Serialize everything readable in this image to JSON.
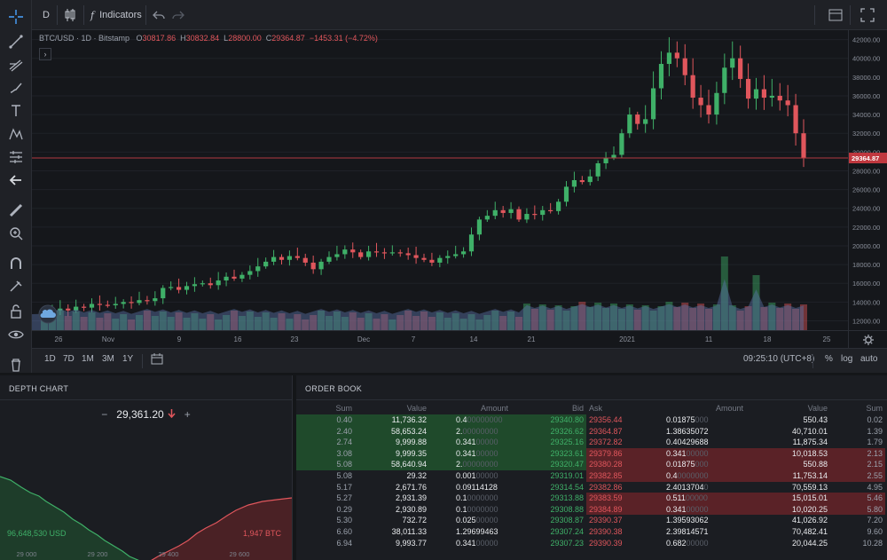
{
  "top_toolbar": {
    "interval": "D",
    "indicators_label": "Indicators",
    "undo_icon": "undo-icon",
    "redo_icon": "redo-icon"
  },
  "legend": {
    "symbol": "BTC/USD · 1D · Bitstamp",
    "open_label": "O",
    "open": "30817.86",
    "high_label": "H",
    "high": "30832.84",
    "low_label": "L",
    "low": "28800.00",
    "close_label": "C",
    "close": "29364.87",
    "change": "−1453.31 (−4.72%)"
  },
  "price_scale": {
    "labels": [
      "42000.00",
      "40000.00",
      "38000.00",
      "36000.00",
      "34000.00",
      "32000.00",
      "30000.00",
      "28000.00",
      "26000.00",
      "24000.00",
      "22000.00",
      "20000.00",
      "18000.00",
      "16000.00",
      "14000.00",
      "12000.00"
    ],
    "current_price_label": "29364.87"
  },
  "time_axis": {
    "labels": [
      "26",
      "Nov",
      "9",
      "16",
      "23",
      "Dec",
      "7",
      "14",
      "21",
      "2021",
      "11",
      "18",
      "25"
    ]
  },
  "bottom_bar": {
    "ranges": [
      "1D",
      "7D",
      "1M",
      "3M",
      "1Y"
    ],
    "time": "09:25:10 (UTC+8)",
    "percent": "%",
    "log": "log",
    "auto": "auto"
  },
  "depth_chart": {
    "title": "DEPTH CHART",
    "minus": "−",
    "mid_price": "29,361.20",
    "plus": "+",
    "bid_volume": "96,648,530 USD",
    "ask_volume": "1,947 BTC",
    "x_labels": [
      "29 000",
      "29 200",
      "29 400",
      "29 600"
    ]
  },
  "order_book": {
    "title": "ORDER BOOK",
    "headers": [
      "Sum",
      "Value",
      "Amount",
      "Bid",
      "Ask",
      "Amount",
      "Value",
      "Sum"
    ],
    "rows": [
      {
        "bsum": "0.40",
        "bval": "11,736.32",
        "bamt": "0.4",
        "bamt_dim": "00000000",
        "bid": "29340.80",
        "ask": "29356.44",
        "aamt": "0.01875",
        "aamt_dim": "000",
        "aval": "550.43",
        "asum": "0.02"
      },
      {
        "bsum": "2.40",
        "bval": "58,653.24",
        "bamt": "2.",
        "bamt_dim": "00000000",
        "bid": "29326.62",
        "ask": "29364.87",
        "aamt": "1.38635072",
        "aamt_dim": "",
        "aval": "40,710.01",
        "asum": "1.39"
      },
      {
        "bsum": "2.74",
        "bval": "9,999.88",
        "bamt": "0.341",
        "bamt_dim": "00000",
        "bid": "29325.16",
        "ask": "29372.82",
        "aamt": "0.40429688",
        "aamt_dim": "",
        "aval": "11,875.34",
        "asum": "1.79"
      },
      {
        "bsum": "3.08",
        "bval": "9,999.35",
        "bamt": "0.341",
        "bamt_dim": "00000",
        "bid": "29323.61",
        "ask": "29379.86",
        "aamt": "0.341",
        "aamt_dim": "00000",
        "aval": "10,018.53",
        "asum": "2.13"
      },
      {
        "bsum": "5.08",
        "bval": "58,640.94",
        "bamt": "2.",
        "bamt_dim": "00000000",
        "bid": "29320.47",
        "ask": "29380.28",
        "aamt": "0.01875",
        "aamt_dim": "000",
        "aval": "550.88",
        "asum": "2.15"
      },
      {
        "bsum": "5.08",
        "bval": "29.32",
        "bamt": "0.001",
        "bamt_dim": "00000",
        "bid": "29319.01",
        "ask": "29382.85",
        "aamt": "0.4",
        "aamt_dim": "0000000",
        "aval": "11,753.14",
        "asum": "2.55"
      },
      {
        "bsum": "5.17",
        "bval": "2,671.76",
        "bamt": "0.09114128",
        "bamt_dim": "",
        "bid": "29314.54",
        "ask": "29382.86",
        "aamt": "2.4013704",
        "aamt_dim": "0",
        "aval": "70,559.13",
        "asum": "4.95"
      },
      {
        "bsum": "5.27",
        "bval": "2,931.39",
        "bamt": "0.1",
        "bamt_dim": "0000000",
        "bid": "29313.88",
        "ask": "29383.59",
        "aamt": "0.511",
        "aamt_dim": "00000",
        "aval": "15,015.01",
        "asum": "5.46"
      },
      {
        "bsum": "0.29",
        "bval": "2,930.89",
        "bamt": "0.1",
        "bamt_dim": "0000000",
        "bid": "29308.88",
        "ask": "29384.89",
        "aamt": "0.341",
        "aamt_dim": "00000",
        "aval": "10,020.25",
        "asum": "5.80"
      },
      {
        "bsum": "5.30",
        "bval": "732.72",
        "bamt": "0.025",
        "bamt_dim": "00000",
        "bid": "29308.87",
        "ask": "29390.37",
        "aamt": "1.39593062",
        "aamt_dim": "",
        "aval": "41,026.92",
        "asum": "7.20"
      },
      {
        "bsum": "6.60",
        "bval": "38,011.33",
        "bamt": "1.29699463",
        "bamt_dim": "",
        "bid": "29307.24",
        "ask": "29390.38",
        "aamt": "2.39814571",
        "aamt_dim": "",
        "aval": "70,482.41",
        "asum": "9.60"
      },
      {
        "bsum": "6.94",
        "bval": "9,993.77",
        "bamt": "0.341",
        "bamt_dim": "00000",
        "bid": "29307.23",
        "ask": "29390.39",
        "aamt": "0.682",
        "aamt_dim": "00000",
        "aval": "20,044.25",
        "asum": "10.28"
      }
    ]
  },
  "colors": {
    "up": "#3fb068",
    "down": "#e0565c",
    "accent": "#4aa4ff"
  }
}
